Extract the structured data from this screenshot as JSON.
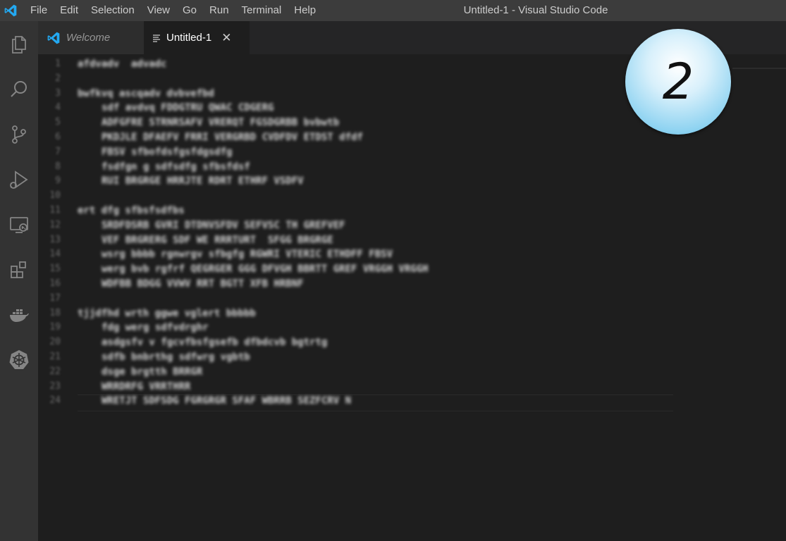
{
  "menu": [
    "File",
    "Edit",
    "Selection",
    "View",
    "Go",
    "Run",
    "Terminal",
    "Help"
  ],
  "window_title": "Untitled-1 - Visual Studio Code",
  "tabs": {
    "welcome": "Welcome",
    "active": "Untitled-1",
    "close": "✕"
  },
  "badge": "2",
  "colors": {
    "titlebar": "#3c3c3c",
    "activity_bar": "#333333",
    "editor": "#1e1e1e",
    "vscode_blue": "#23a9f2"
  },
  "editor": {
    "line_numbers": [
      "1",
      "2",
      "3",
      "4",
      "5",
      "6",
      "7",
      "8",
      "9",
      "10",
      "11",
      "12",
      "13",
      "14",
      "15",
      "16",
      "17",
      "18",
      "19",
      "20",
      "21",
      "22",
      "23",
      "24"
    ],
    "lines": [
      "afdvadv  advadc",
      "",
      "bwfkvq ascqadv dvbvefbd",
      "sdf avdvq FDDGTRU QWAC CDGERG",
      "ADFGFRE STRNRSAFV VRERQT FGSDGRBB bvbwtb",
      "PKDJLE DFAEFV FRRI VERGRBD CVDFDV ETDST dfdf",
      "FBSV sfbofdsfgsfdgsdfg",
      "fsdfgn g sdfsdfg sfbsfdsf",
      "RUI BRGRGE HRRJTE RDRT ETHRF VSDFV",
      "",
      "ert dfg sfbsfsdfbs",
      "SRDFDSRB GVRI DTDNVSFDV SEFVSC TH GREFVEF",
      "VEF BRGRERG SDF WE RRRTURT  SFGG BRGRGE",
      "wsrg bbbb rgnwrgv sfbgfg RGWRI VTERIC ETHDFF FBSV",
      "werg bvb rgfrf QEGRGER GGG DFVGH BBRTT GREF VRGGH VRGGH",
      "WDFBB BDGG VVWV RRT BGTT XFB HRBNF",
      "",
      "tjjdfhd wrth ggwe vglert bbbbb",
      "fdg werg sdfvdrghr",
      "asdgsfv v fgcvfbsfgsefb dfbdcvb bgtrtg",
      "sdfb bnbrthg sdfwrg vgbtb",
      "dsge brgtth BRRGR",
      "WRRDRFG VRRTHRR",
      "WRETJT SDFSDG FGRGRGR SFAF WBRRB SEZFCRV N"
    ]
  }
}
